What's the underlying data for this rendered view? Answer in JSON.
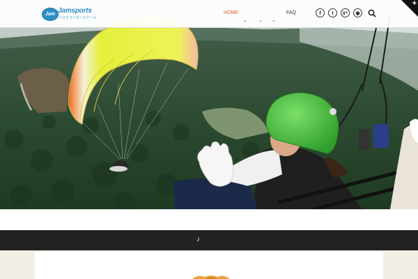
{
  "brand": {
    "badge": "Jam",
    "name": "Jamsports",
    "subtitle": "パラグライダースクール"
  },
  "nav": {
    "items": [
      {
        "label": "HOME",
        "active": true
      },
      {
        "label": "",
        "active": false
      },
      {
        "label": "",
        "active": false
      },
      {
        "label": "FAQ",
        "active": false
      }
    ]
  },
  "social": [
    {
      "icon": "facebook-icon",
      "glyph": "f"
    },
    {
      "icon": "twitter-icon",
      "glyph": "t"
    },
    {
      "icon": "google-plus-icon",
      "glyph": "g+"
    },
    {
      "icon": "cart-icon",
      "glyph": "◉"
    }
  ],
  "footer_bar": {
    "icon_glyph": "♪"
  },
  "colors": {
    "accent": "#e8602c",
    "brand_blue": "#2d8fc7",
    "dark_bar": "#222222",
    "canopy_yellow": "#e4f03a",
    "canopy_orange": "#f06a1e",
    "helmet_green": "#4dc63a"
  }
}
